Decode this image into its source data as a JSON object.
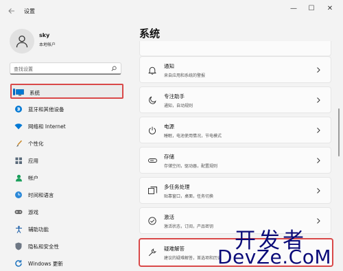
{
  "window": {
    "title": "设置",
    "controls": {
      "minimize": "—",
      "maximize": "☐",
      "close": "✕"
    }
  },
  "user": {
    "name": "sky",
    "account_type": "本地帐户"
  },
  "search": {
    "placeholder": "查找设置"
  },
  "sidebar": {
    "items": [
      {
        "label": "系统",
        "icon": "monitor-icon",
        "selected": true
      },
      {
        "label": "蓝牙和其他设备",
        "icon": "bluetooth-icon"
      },
      {
        "label": "网络和 Internet",
        "icon": "wifi-icon"
      },
      {
        "label": "个性化",
        "icon": "brush-icon"
      },
      {
        "label": "应用",
        "icon": "apps-icon"
      },
      {
        "label": "帐户",
        "icon": "person-icon"
      },
      {
        "label": "时间和语言",
        "icon": "globe-clock-icon"
      },
      {
        "label": "游戏",
        "icon": "gamepad-icon"
      },
      {
        "label": "辅助功能",
        "icon": "accessibility-icon"
      },
      {
        "label": "隐私和安全性",
        "icon": "shield-icon"
      },
      {
        "label": "Windows 更新",
        "icon": "update-icon"
      }
    ]
  },
  "main": {
    "title": "系统",
    "cards": [
      {
        "title": "通知",
        "subtitle": "来自应用和系统的警报",
        "icon": "bell-icon"
      },
      {
        "title": "专注助手",
        "subtitle": "通知，自动规则",
        "icon": "moon-icon"
      },
      {
        "title": "电源",
        "subtitle": "睡眠，电池使用情况，节电模式",
        "icon": "power-icon"
      },
      {
        "title": "存储",
        "subtitle": "存储空间，驱动器，配置规则",
        "icon": "storage-icon"
      },
      {
        "title": "多任务处理",
        "subtitle": "贴靠窗口，桌面，任务切换",
        "icon": "multitask-icon"
      },
      {
        "title": "激活",
        "subtitle": "激活状态，订阅，产品密钥",
        "icon": "check-circle-icon"
      },
      {
        "title": "疑难解答",
        "subtitle": "建议的疑难解答，首选项和历史",
        "icon": "wrench-icon",
        "highlighted": true
      }
    ]
  },
  "watermark": {
    "line1": "开发者",
    "line2": "DevZe.CoM"
  },
  "colors": {
    "accent": "#0067c0",
    "highlight_border": "#d94848",
    "watermark": "#0a0a78"
  }
}
